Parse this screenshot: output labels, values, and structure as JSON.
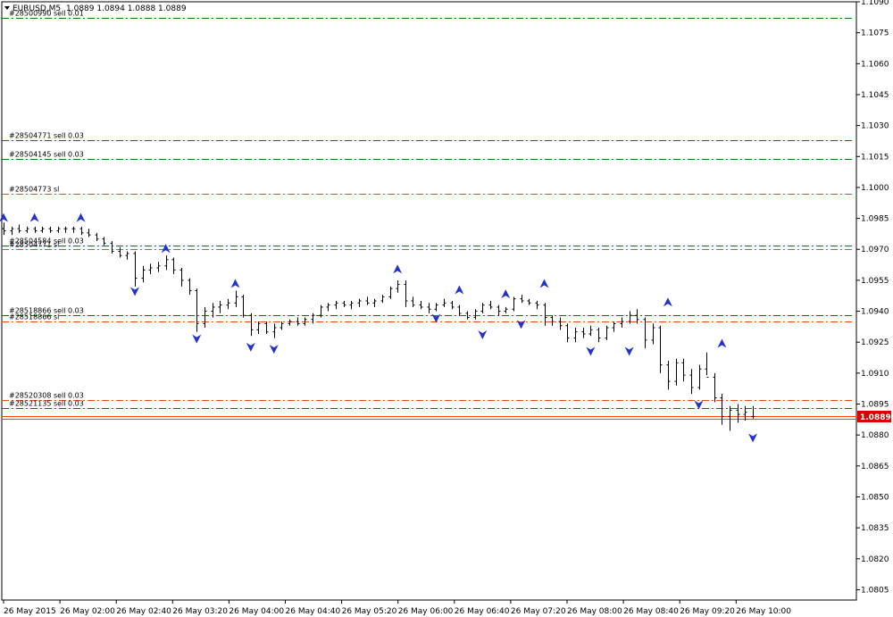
{
  "header": {
    "symbol": "EURUSD,M5",
    "ohlc": "1.0889 1.0894 1.0888 1.0889"
  },
  "price_marker": {
    "value": "1.0889",
    "color": "#dd0000"
  },
  "colors": {
    "bar": "#000000",
    "sell_line": "#008000",
    "sl_line": "#ff4500",
    "arrow": "#2233cc",
    "current": "#ff4500"
  },
  "chart_data": {
    "type": "line",
    "ylim": [
      1.08,
      1.109
    ],
    "y_ticks": [
      "1.1090",
      "1.1075",
      "1.1060",
      "1.1045",
      "1.1030",
      "1.1015",
      "1.1000",
      "1.0985",
      "1.0970",
      "1.0955",
      "1.0940",
      "1.0925",
      "1.0910",
      "1.0895",
      "1.0880",
      "1.0865",
      "1.0850",
      "1.0835",
      "1.0820",
      "1.0805"
    ],
    "x_ticks": [
      "26 May 2015",
      "26 May 02:00",
      "26 May 02:40",
      "26 May 03:20",
      "26 May 04:00",
      "26 May 04:40",
      "26 May 05:20",
      "26 May 06:00",
      "26 May 06:40",
      "26 May 07:20",
      "26 May 08:00",
      "26 May 08:40",
      "26 May 09:20",
      "26 May 10:00"
    ],
    "ohlc": [
      [
        1.098,
        1.0983,
        1.0977,
        1.0979
      ],
      [
        1.0979,
        1.0981,
        1.0977,
        1.098
      ],
      [
        1.098,
        1.0982,
        1.0978,
        1.0979
      ],
      [
        1.0979,
        1.0981,
        1.0978,
        1.098
      ],
      [
        1.098,
        1.0981,
        1.0978,
        1.0979
      ],
      [
        1.0979,
        1.0981,
        1.0978,
        1.098
      ],
      [
        1.098,
        1.0981,
        1.0978,
        1.0979
      ],
      [
        1.0979,
        1.0981,
        1.0978,
        1.098
      ],
      [
        1.098,
        1.0981,
        1.0978,
        1.098
      ],
      [
        1.098,
        1.0981,
        1.0978,
        1.098
      ],
      [
        1.098,
        1.0981,
        1.0977,
        1.0978
      ],
      [
        1.0978,
        1.098,
        1.0976,
        1.0977
      ],
      [
        1.0977,
        1.0978,
        1.0974,
        1.0975
      ],
      [
        1.0975,
        1.0976,
        1.0972,
        1.0973
      ],
      [
        1.0973,
        1.0974,
        1.0968,
        1.0969
      ],
      [
        1.0969,
        1.0971,
        1.0966,
        1.0967
      ],
      [
        1.0967,
        1.0969,
        1.0965,
        1.0968
      ],
      [
        1.0968,
        1.0969,
        1.0952,
        1.0956
      ],
      [
        1.0956,
        1.0962,
        1.0954,
        1.096
      ],
      [
        1.096,
        1.0963,
        1.0958,
        1.0961
      ],
      [
        1.0961,
        1.0964,
        1.0959,
        1.0962
      ],
      [
        1.0962,
        1.0967,
        1.096,
        1.0965
      ],
      [
        1.0965,
        1.0966,
        1.0958,
        1.096
      ],
      [
        1.096,
        1.0961,
        1.0952,
        1.0955
      ],
      [
        1.0955,
        1.0956,
        1.0948,
        1.095
      ],
      [
        1.095,
        1.0951,
        1.093,
        1.0934
      ],
      [
        1.0934,
        1.0942,
        1.0932,
        1.094
      ],
      [
        1.094,
        1.0944,
        1.0937,
        1.0942
      ],
      [
        1.0942,
        1.0945,
        1.0939,
        1.0943
      ],
      [
        1.0943,
        1.0946,
        1.0941,
        1.0944
      ],
      [
        1.0944,
        1.095,
        1.0942,
        1.0947
      ],
      [
        1.0947,
        1.0948,
        1.0937,
        1.0938
      ],
      [
        1.0938,
        1.0939,
        1.0928,
        1.0931
      ],
      [
        1.0931,
        1.0935,
        1.0929,
        1.0934
      ],
      [
        1.0934,
        1.0935,
        1.0929,
        1.093
      ],
      [
        1.093,
        1.0934,
        1.0927,
        1.0932
      ],
      [
        1.0932,
        1.0935,
        1.0931,
        1.0934
      ],
      [
        1.0934,
        1.0936,
        1.0933,
        1.0935
      ],
      [
        1.0935,
        1.0937,
        1.0933,
        1.0934
      ],
      [
        1.0934,
        1.0937,
        1.0933,
        1.0936
      ],
      [
        1.0936,
        1.0939,
        1.0934,
        1.0938
      ],
      [
        1.0938,
        1.0943,
        1.0937,
        1.0942
      ],
      [
        1.0942,
        1.0944,
        1.094,
        1.0943
      ],
      [
        1.0943,
        1.0945,
        1.0941,
        1.0944
      ],
      [
        1.0944,
        1.0945,
        1.0942,
        1.0943
      ],
      [
        1.0943,
        1.0945,
        1.0941,
        1.0944
      ],
      [
        1.0944,
        1.0946,
        1.0942,
        1.0945
      ],
      [
        1.0945,
        1.0947,
        1.0943,
        1.0944
      ],
      [
        1.0944,
        1.0946,
        1.0942,
        1.0945
      ],
      [
        1.0945,
        1.0948,
        1.0944,
        1.0947
      ],
      [
        1.0947,
        1.0952,
        1.0946,
        1.0951
      ],
      [
        1.0951,
        1.0955,
        1.0949,
        1.0953
      ],
      [
        1.0953,
        1.0955,
        1.0942,
        1.0945
      ],
      [
        1.0945,
        1.0947,
        1.0942,
        1.0943
      ],
      [
        1.0943,
        1.0945,
        1.0941,
        1.0942
      ],
      [
        1.0942,
        1.0944,
        1.0939,
        1.0941
      ],
      [
        1.0941,
        1.0944,
        1.094,
        1.0943
      ],
      [
        1.0943,
        1.0946,
        1.0942,
        1.0944
      ],
      [
        1.0944,
        1.0945,
        1.0941,
        1.0942
      ],
      [
        1.0942,
        1.0943,
        1.0938,
        1.0939
      ],
      [
        1.0939,
        1.094,
        1.0936,
        1.0937
      ],
      [
        1.0937,
        1.0941,
        1.0936,
        1.094
      ],
      [
        1.094,
        1.0944,
        1.0939,
        1.0943
      ],
      [
        1.0943,
        1.0945,
        1.0941,
        1.0942
      ],
      [
        1.0942,
        1.0943,
        1.0938,
        1.094
      ],
      [
        1.094,
        1.0942,
        1.0939,
        1.0941
      ],
      [
        1.0941,
        1.0947,
        1.094,
        1.0946
      ],
      [
        1.0946,
        1.0948,
        1.0944,
        1.0945
      ],
      [
        1.0945,
        1.0946,
        1.0943,
        1.0944
      ],
      [
        1.0944,
        1.0945,
        1.0941,
        1.0943
      ],
      [
        1.0943,
        1.0944,
        1.0933,
        1.0937
      ],
      [
        1.0937,
        1.0938,
        1.0933,
        1.0935
      ],
      [
        1.0935,
        1.0937,
        1.0931,
        1.0933
      ],
      [
        1.0933,
        1.0934,
        1.0925,
        1.0927
      ],
      [
        1.0927,
        1.0932,
        1.0925,
        1.093
      ],
      [
        1.093,
        1.0932,
        1.0927,
        1.0929
      ],
      [
        1.0929,
        1.0933,
        1.0928,
        1.0931
      ],
      [
        1.0931,
        1.0932,
        1.0925,
        1.0927
      ],
      [
        1.0927,
        1.0933,
        1.0926,
        1.0932
      ],
      [
        1.0932,
        1.0935,
        1.093,
        1.0934
      ],
      [
        1.0934,
        1.0937,
        1.0932,
        1.0935
      ],
      [
        1.0935,
        1.094,
        1.0934,
        1.0938
      ],
      [
        1.0938,
        1.0941,
        1.0934,
        1.0936
      ],
      [
        1.0936,
        1.0937,
        1.0922,
        1.0926
      ],
      [
        1.0926,
        1.0934,
        1.0924,
        1.0932
      ],
      [
        1.0932,
        1.0933,
        1.091,
        1.0914
      ],
      [
        1.0914,
        1.0916,
        1.0902,
        1.0906
      ],
      [
        1.0906,
        1.0917,
        1.0904,
        1.0915
      ],
      [
        1.0915,
        1.0917,
        1.0906,
        1.0909
      ],
      [
        1.0909,
        1.0912,
        1.09,
        1.0903
      ],
      [
        1.0903,
        1.0914,
        1.0902,
        1.0912
      ],
      [
        1.0912,
        1.092,
        1.0909,
        1.0908
      ],
      [
        1.0908,
        1.091,
        1.0896,
        1.0898
      ],
      [
        1.0898,
        1.09,
        1.0885,
        1.0889
      ],
      [
        1.0889,
        1.0894,
        1.0882,
        1.0892
      ],
      [
        1.0892,
        1.0895,
        1.0886,
        1.089
      ],
      [
        1.089,
        1.0894,
        1.0887,
        1.0891
      ],
      [
        1.0889,
        1.0894,
        1.0888,
        1.0889
      ]
    ],
    "order_lines": [
      {
        "label": "#28500990 sell 0.01",
        "price": 1.1082,
        "kind": "sell"
      },
      {
        "label": "#28504771 sell 0.03",
        "price": 1.1023,
        "kind": "sell"
      },
      {
        "label": "#28504145 sell 0.03",
        "price": 1.1014,
        "kind": "sell"
      },
      {
        "label": "#28504773 sl",
        "price": 1.0997,
        "kind": "sl"
      },
      {
        "label": "#28504584 sell 0.03",
        "price": 1.0972,
        "kind": "sell"
      },
      {
        "label": "#28504771 sl",
        "price": 1.097,
        "kind": "sl"
      },
      {
        "label": "#28518866 sell 0.03",
        "price": 1.0938,
        "kind": "sell"
      },
      {
        "label": "#28518866 sl",
        "price": 1.0935,
        "kind": "sl"
      },
      {
        "label": "#28520308 sell 0.03",
        "price": 1.0897,
        "kind": "sl"
      },
      {
        "label": "#28521135 sell 0.03",
        "price": 1.0893,
        "kind": "sell"
      }
    ],
    "arrows": [
      {
        "bar": 0,
        "price": 1.0985,
        "dir": "up"
      },
      {
        "bar": 4,
        "price": 1.0985,
        "dir": "up"
      },
      {
        "bar": 10,
        "price": 1.0985,
        "dir": "up"
      },
      {
        "bar": 17,
        "price": 1.095,
        "dir": "down"
      },
      {
        "bar": 21,
        "price": 1.097,
        "dir": "up"
      },
      {
        "bar": 25,
        "price": 1.0927,
        "dir": "down"
      },
      {
        "bar": 30,
        "price": 1.0953,
        "dir": "up"
      },
      {
        "bar": 32,
        "price": 1.0923,
        "dir": "down"
      },
      {
        "bar": 35,
        "price": 1.0922,
        "dir": "down"
      },
      {
        "bar": 51,
        "price": 1.096,
        "dir": "up"
      },
      {
        "bar": 56,
        "price": 1.0937,
        "dir": "down"
      },
      {
        "bar": 59,
        "price": 1.095,
        "dir": "up"
      },
      {
        "bar": 62,
        "price": 1.0929,
        "dir": "down"
      },
      {
        "bar": 65,
        "price": 1.0948,
        "dir": "up"
      },
      {
        "bar": 67,
        "price": 1.0934,
        "dir": "down"
      },
      {
        "bar": 70,
        "price": 1.0953,
        "dir": "up"
      },
      {
        "bar": 76,
        "price": 1.0921,
        "dir": "down"
      },
      {
        "bar": 81,
        "price": 1.0921,
        "dir": "down"
      },
      {
        "bar": 86,
        "price": 1.0944,
        "dir": "up"
      },
      {
        "bar": 90,
        "price": 1.0895,
        "dir": "down"
      },
      {
        "bar": 93,
        "price": 1.0924,
        "dir": "up"
      },
      {
        "bar": 97,
        "price": 1.0879,
        "dir": "down"
      }
    ]
  }
}
